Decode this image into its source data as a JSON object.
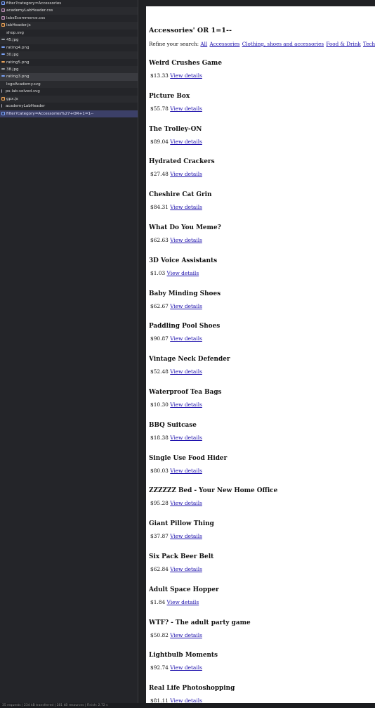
{
  "devtools": {
    "files": [
      {
        "name": "filter?category=Accessories",
        "icon": "document-icon",
        "kind": "doc",
        "style": ""
      },
      {
        "name": "academyLabHeader.css",
        "icon": "stylesheet-icon",
        "kind": "css",
        "style": ""
      },
      {
        "name": "labsEcommerce.css",
        "icon": "stylesheet-icon",
        "kind": "css",
        "style": ""
      },
      {
        "name": "labHeader.js",
        "icon": "script-icon",
        "kind": "js",
        "style": ""
      },
      {
        "name": "shop.svg",
        "icon": "svg-icon",
        "kind": "svg",
        "style": ""
      },
      {
        "name": "45.jpg",
        "icon": "image-icon",
        "kind": "img g",
        "style": ""
      },
      {
        "name": "rating4.png",
        "icon": "image-icon",
        "kind": "img",
        "style": ""
      },
      {
        "name": "30.jpg",
        "icon": "image-icon",
        "kind": "img",
        "style": ""
      },
      {
        "name": "rating5.png",
        "icon": "image-icon",
        "kind": "img o",
        "style": ""
      },
      {
        "name": "38.jpg",
        "icon": "image-icon",
        "kind": "img g",
        "style": ""
      },
      {
        "name": "rating3.png",
        "icon": "image-icon",
        "kind": "img",
        "style": "dim"
      },
      {
        "name": "logoAcademy.svg",
        "icon": "svg-icon",
        "kind": "svg",
        "style": ""
      },
      {
        "name": "ps-lab-solved.svg",
        "icon": "font-icon",
        "kind": "font",
        "style": ""
      },
      {
        "name": "gpx.js",
        "icon": "script-icon",
        "kind": "js",
        "style": ""
      },
      {
        "name": "academyLabHeader",
        "icon": "websocket-icon",
        "kind": "font",
        "style": ""
      },
      {
        "name": "filter?category=Accessories%27+OR+1=1--",
        "icon": "document-icon",
        "kind": "doc",
        "style": "sel"
      }
    ],
    "status": "35 requests | 234 kB transferred | 281 kB resources | Finish: 2.72 s"
  },
  "page": {
    "title": "Accessories' OR 1=1--",
    "refine_label": "Refine your search:",
    "categories": [
      "All",
      "Accessories",
      "Clothing, shoes and accessories",
      "Food & Drink",
      "Tech gifts"
    ],
    "view_details_label": "View details",
    "products": [
      {
        "name": "Weird Crushes Game",
        "price": "$13.33"
      },
      {
        "name": "Picture Box",
        "price": "$55.78"
      },
      {
        "name": "The Trolley-ON",
        "price": "$89.04"
      },
      {
        "name": "Hydrated Crackers",
        "price": "$27.48"
      },
      {
        "name": "Cheshire Cat Grin",
        "price": "$84.31"
      },
      {
        "name": "What Do You Meme?",
        "price": "$62.63"
      },
      {
        "name": "3D Voice Assistants",
        "price": "$1.03"
      },
      {
        "name": "Baby Minding Shoes",
        "price": "$62.67"
      },
      {
        "name": "Paddling Pool Shoes",
        "price": "$90.87"
      },
      {
        "name": "Vintage Neck Defender",
        "price": "$52.48"
      },
      {
        "name": "Waterproof Tea Bags",
        "price": "$10.30"
      },
      {
        "name": "BBQ Suitcase",
        "price": "$18.38"
      },
      {
        "name": "Single Use Food Hider",
        "price": "$80.03"
      },
      {
        "name": "ZZZZZZ Bed - Your New Home Office",
        "price": "$95.28"
      },
      {
        "name": "Giant Pillow Thing",
        "price": "$37.87"
      },
      {
        "name": "Six Pack Beer Belt",
        "price": "$62.84"
      },
      {
        "name": "Adult Space Hopper",
        "price": "$1.84"
      },
      {
        "name": "WTF? - The adult party game",
        "price": "$50.82"
      },
      {
        "name": "Lightbulb Moments",
        "price": "$92.74"
      },
      {
        "name": "Real Life Photoshopping",
        "price": "$81.11"
      }
    ]
  }
}
